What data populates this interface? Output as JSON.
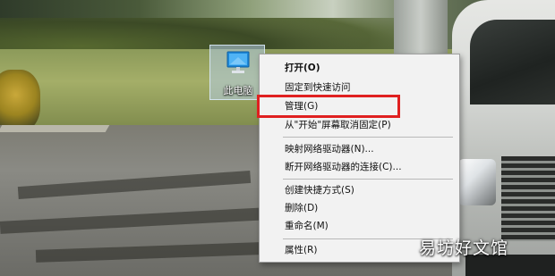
{
  "desktop_icon": {
    "label": "此电脑",
    "icon": "monitor-icon"
  },
  "context_menu": {
    "items": [
      {
        "label": "打开(O)",
        "bold": true
      },
      {
        "label": "固定到快速访问"
      },
      {
        "label": "管理(G)",
        "highlighted": true
      },
      {
        "label": "从\"开始\"屏幕取消固定(P)"
      },
      {
        "label": "映射网络驱动器(N)..."
      },
      {
        "label": "断开网络驱动器的连接(C)..."
      },
      {
        "label": "创建快捷方式(S)"
      },
      {
        "label": "删除(D)"
      },
      {
        "label": "重命名(M)"
      },
      {
        "label": "属性(R)"
      }
    ]
  },
  "highlight": {
    "color": "#e02020"
  },
  "watermark": {
    "text": "易坊好文馆"
  }
}
